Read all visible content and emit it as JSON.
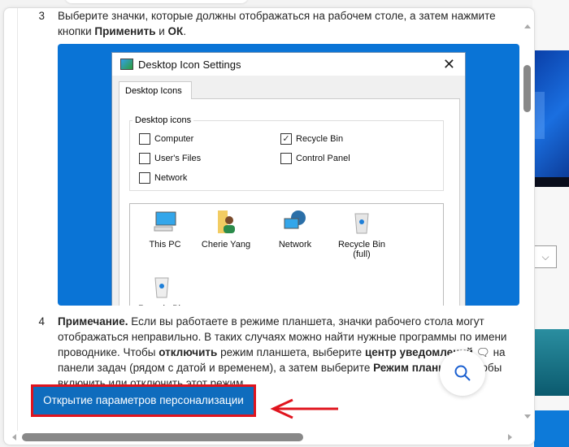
{
  "steps": [
    {
      "number": "3",
      "text_parts": [
        "Выберите значки, которые должны отображаться на рабочем столе, а затем нажмите кнопки ",
        "Применить",
        " и ",
        "ОК",
        "."
      ]
    },
    {
      "number": "4",
      "text_parts": [
        "Примечание.",
        " Если вы работаете в режиме планшета, значки рабочего стола могут отображаться неправильно. В таких случаях можно найти нужные программы по имени проводнике. Чтобы ",
        "отключить",
        " режим планшета, выберите ",
        "центр уведомлений",
        " на панели задач (рядом с датой и временем), а затем выберите ",
        "Режим планшета",
        ", чтобы включить или отключить этот режим."
      ]
    }
  ],
  "dialog": {
    "title": "Desktop Icon Settings",
    "close_glyph": "✕",
    "tab_label": "Desktop Icons",
    "group_label": "Desktop icons",
    "checkboxes": [
      {
        "label": "Computer",
        "checked": false
      },
      {
        "label": "Recycle Bin",
        "checked": true
      },
      {
        "label": "User's Files",
        "checked": false
      },
      {
        "label": "Control Panel",
        "checked": false
      },
      {
        "label": "Network",
        "checked": false
      }
    ],
    "icons": [
      {
        "label": "This PC",
        "icon": "monitor-icon"
      },
      {
        "label": "Cherie Yang",
        "icon": "user-folder-icon"
      },
      {
        "label": "Network",
        "icon": "network-globe-icon"
      },
      {
        "label": "Recycle Bin\n(full)",
        "icon": "recycle-bin-full-icon"
      },
      {
        "label": "Recycle Bin",
        "icon": "recycle-bin-empty-icon"
      }
    ]
  },
  "button": {
    "label": "Открытие параметров персонализации"
  },
  "colors": {
    "accent": "#0f6cbd",
    "highlight_border": "#e0141e",
    "screenshot_bg": "#0a74d6"
  }
}
